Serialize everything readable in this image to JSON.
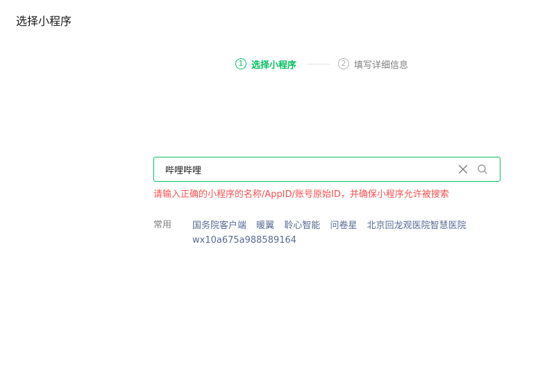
{
  "page": {
    "title": "选择小程序"
  },
  "steps": [
    {
      "number": "1",
      "label": "选择小程序",
      "state": "active"
    },
    {
      "number": "2",
      "label": "填写详细信息",
      "state": "inactive"
    }
  ],
  "search": {
    "value": "哔哩哔哩",
    "placeholder": "",
    "clear_icon": "close-icon",
    "search_icon": "search-icon"
  },
  "error": {
    "message": "请输入正确的小程序的名称/AppID/账号原始ID，并确保小程序允许被搜索"
  },
  "common": {
    "label": "常用",
    "items": [
      "国务院客户端",
      "暖翼",
      "聆心智能",
      "问卷星",
      "北京回龙观医院智慧医院",
      "wx10a675a988589164"
    ]
  },
  "colors": {
    "accent": "#07c160",
    "error": "#fa5151",
    "link": "#576b95",
    "muted": "#7f7f7f"
  }
}
